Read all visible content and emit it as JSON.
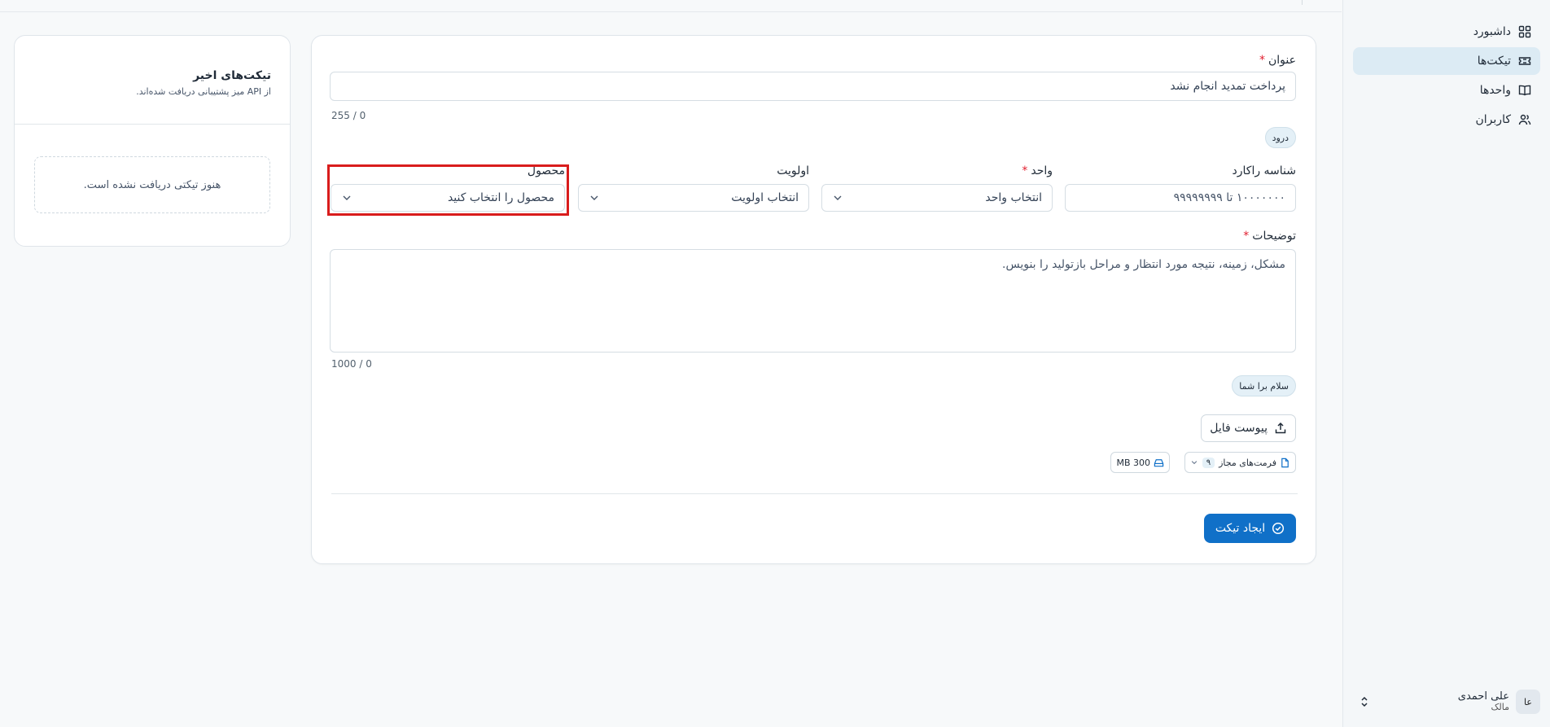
{
  "sidebar": {
    "items": [
      {
        "label": "داشبورد",
        "icon": "dashboard-icon",
        "active": false
      },
      {
        "label": "تیکت‌ها",
        "icon": "ticket-icon",
        "active": true
      },
      {
        "label": "واحدها",
        "icon": "book-icon",
        "active": false
      },
      {
        "label": "کاربران",
        "icon": "users-icon",
        "active": false
      }
    ],
    "user": {
      "initials": "عا",
      "name": "علی احمدی",
      "role": "مالک"
    }
  },
  "form": {
    "title_label": "عنوان",
    "title_value": "پرداخت تمدید انجام نشد",
    "title_counter": "255 / 0",
    "title_chip": "درود",
    "tracking_label": "شناسه راکارد",
    "tracking_placeholder": "۱۰۰۰۰۰۰۰ تا ۹۹۹۹۹۹۹۹",
    "unit_label": "واحد",
    "unit_placeholder": "انتخاب واحد",
    "priority_label": "اولویت",
    "priority_placeholder": "انتخاب اولویت",
    "product_label": "محصول",
    "product_placeholder": "محصول را انتخاب کنید",
    "description_label": "توضیحات",
    "description_placeholder": "مشکل، زمینه، نتیجه مورد انتظار و مراحل بازتولید را بنویس.",
    "description_counter": "1000 / 0",
    "description_chip": "سلام برا شما",
    "attach_label": "پیوست فایل",
    "formats_label": "فرمت‌های مجاز",
    "formats_count": "۹",
    "size_label": "300 MB",
    "submit_label": "ایجاد تیکت"
  },
  "recent": {
    "title": "تیکت‌های اخیر",
    "subtitle": "از API میز پشتیبانی دریافت شده‌اند.",
    "empty": "هنوز تیکتی دریافت نشده است."
  },
  "colors": {
    "primary": "#1070c8",
    "required": "#e11d2e",
    "highlight": "#d91c1c",
    "active_nav": "#dcebf4"
  }
}
